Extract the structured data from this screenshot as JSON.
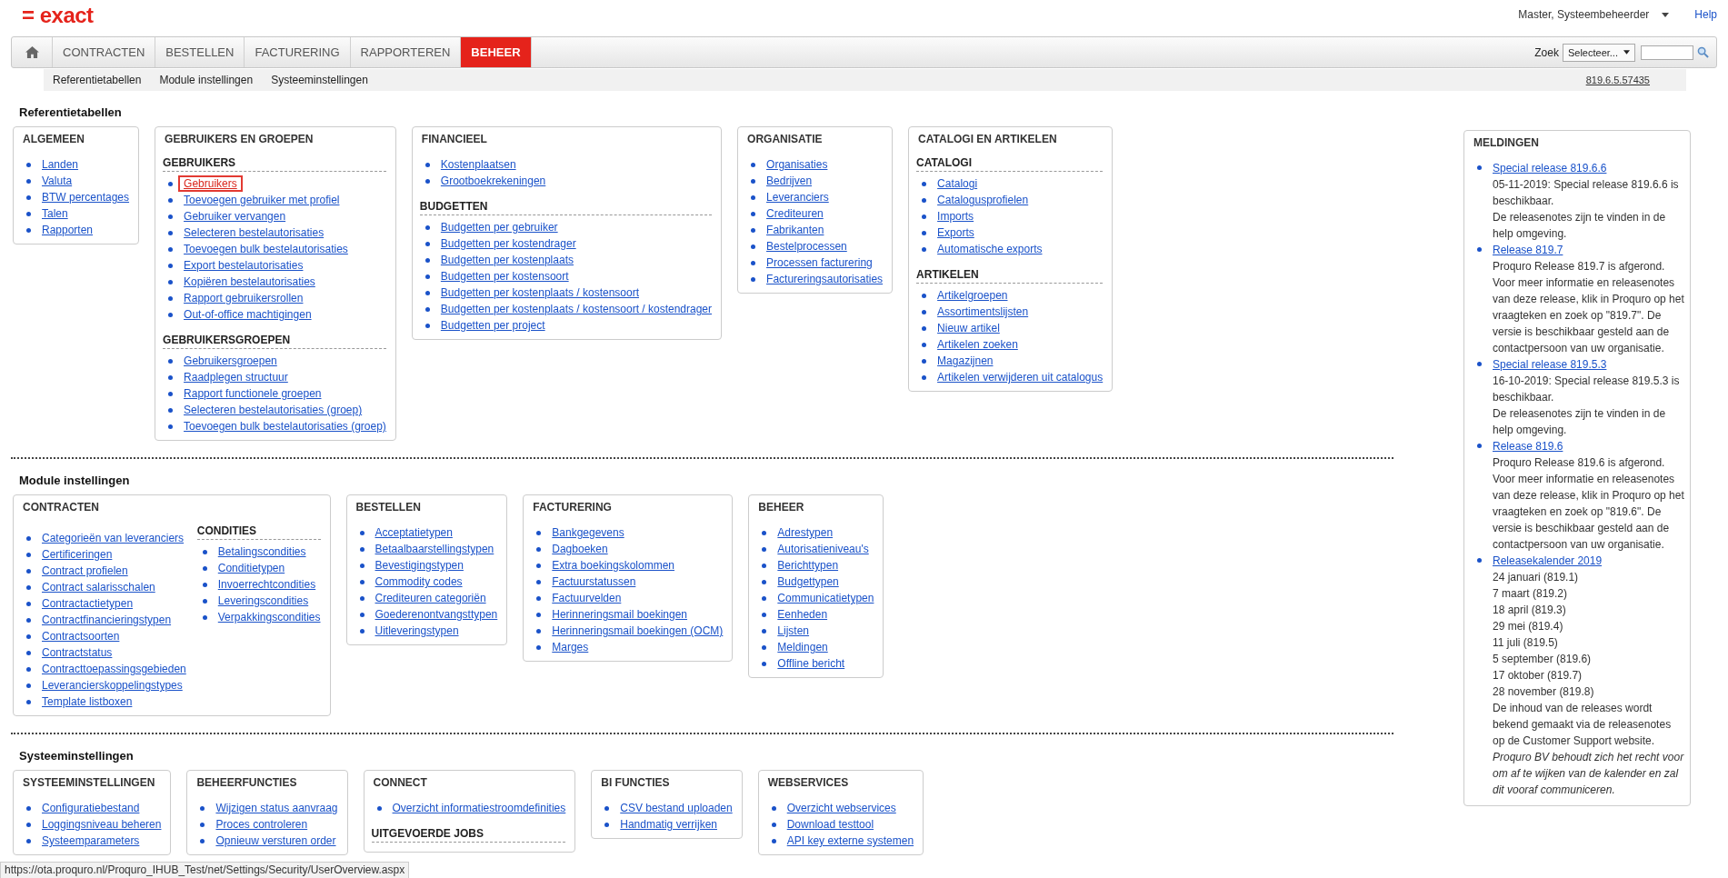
{
  "header": {
    "logo": "= exact",
    "user": "Master, Systeembeheerder",
    "help": "Help"
  },
  "nav": {
    "tabs": [
      {
        "label": "CONTRACTEN",
        "selected": false
      },
      {
        "label": "BESTELLEN",
        "selected": false
      },
      {
        "label": "FACTURERING",
        "selected": false
      },
      {
        "label": "RAPPORTEREN",
        "selected": false
      },
      {
        "label": "BEHEER",
        "selected": true
      }
    ],
    "search": {
      "label": "Zoek",
      "select": "Selecteer..."
    }
  },
  "subnav": {
    "links": [
      "Referentietabellen",
      "Module instellingen",
      "Systeeminstellingen"
    ],
    "version": "819.6.5.57435"
  },
  "sections": [
    {
      "title": "Referentietabellen",
      "boxes": [
        {
          "title": "ALGEMEEN",
          "kind": "stack",
          "groups": [
            {
              "links": [
                {
                  "label": "Landen",
                  "selected": false
                },
                {
                  "label": "Valuta",
                  "selected": false
                },
                {
                  "label": "BTW percentages",
                  "selected": false
                },
                {
                  "label": "Talen",
                  "selected": false
                },
                {
                  "label": "Rapporten",
                  "selected": false
                }
              ]
            }
          ]
        },
        {
          "title": "GEBRUIKERS EN GROEPEN",
          "kind": "stack",
          "groups": [
            {
              "heading": "GEBRUIKERS",
              "links": [
                {
                  "label": "Gebruikers",
                  "selected": true
                },
                {
                  "label": "Toevoegen gebruiker met profiel",
                  "selected": false
                },
                {
                  "label": "Gebruiker vervangen",
                  "selected": false
                },
                {
                  "label": "Selecteren bestelautorisaties",
                  "selected": false
                },
                {
                  "label": "Toevoegen bulk bestelautorisaties",
                  "selected": false
                },
                {
                  "label": "Export bestelautorisaties",
                  "selected": false
                },
                {
                  "label": "Kopiëren bestelautorisaties",
                  "selected": false
                },
                {
                  "label": "Rapport gebruikersrollen",
                  "selected": false
                },
                {
                  "label": "Out-of-office machtigingen",
                  "selected": false
                }
              ]
            },
            {
              "heading": "GEBRUIKERSGROEPEN",
              "links": [
                {
                  "label": "Gebruikersgroepen",
                  "selected": false
                },
                {
                  "label": "Raadplegen structuur",
                  "selected": false
                },
                {
                  "label": "Rapport functionele groepen",
                  "selected": false
                },
                {
                  "label": "Selecteren bestelautorisaties (groep)",
                  "selected": false
                },
                {
                  "label": "Toevoegen bulk bestelautorisaties (groep)",
                  "selected": false
                }
              ]
            }
          ]
        },
        {
          "title": "FINANCIEEL",
          "kind": "stack",
          "groups": [
            {
              "links": [
                {
                  "label": "Kostenplaatsen",
                  "selected": false
                },
                {
                  "label": "Grootboekrekeningen",
                  "selected": false
                }
              ]
            },
            {
              "heading": "BUDGETTEN",
              "links": [
                {
                  "label": "Budgetten per gebruiker",
                  "selected": false
                },
                {
                  "label": "Budgetten per kostendrager",
                  "selected": false
                },
                {
                  "label": "Budgetten per kostenplaats",
                  "selected": false
                },
                {
                  "label": "Budgetten per kostensoort",
                  "selected": false
                },
                {
                  "label": "Budgetten per kostenplaats / kostensoort",
                  "selected": false
                },
                {
                  "label": "Budgetten per kostenplaats / kostensoort / kostendrager",
                  "selected": false
                },
                {
                  "label": "Budgetten per project",
                  "selected": false
                }
              ]
            }
          ]
        },
        {
          "title": "ORGANISATIE",
          "kind": "stack",
          "groups": [
            {
              "links": [
                {
                  "label": "Organisaties",
                  "selected": false
                },
                {
                  "label": "Bedrijven",
                  "selected": false
                },
                {
                  "label": "Leveranciers",
                  "selected": false
                },
                {
                  "label": "Crediteuren",
                  "selected": false
                },
                {
                  "label": "Fabrikanten",
                  "selected": false
                },
                {
                  "label": "Bestelprocessen",
                  "selected": false
                },
                {
                  "label": "Processen facturering",
                  "selected": false
                },
                {
                  "label": "Factureringsautorisaties",
                  "selected": false
                }
              ]
            }
          ]
        },
        {
          "title": "CATALOGI EN ARTIKELEN",
          "kind": "stack",
          "groups": [
            {
              "heading": "CATALOGI",
              "links": [
                {
                  "label": "Catalogi",
                  "selected": false
                },
                {
                  "label": "Catalogusprofielen",
                  "selected": false
                },
                {
                  "label": "Imports",
                  "selected": false
                },
                {
                  "label": "Exports",
                  "selected": false
                },
                {
                  "label": "Automatische exports",
                  "selected": false
                }
              ]
            },
            {
              "heading": "ARTIKELEN",
              "links": [
                {
                  "label": "Artikelgroepen",
                  "selected": false
                },
                {
                  "label": "Assortimentslijsten",
                  "selected": false
                },
                {
                  "label": "Nieuw artikel",
                  "selected": false
                },
                {
                  "label": "Artikelen zoeken",
                  "selected": false
                },
                {
                  "label": "Magazijnen",
                  "selected": false
                },
                {
                  "label": "Artikelen verwijderen uit catalogus",
                  "selected": false
                }
              ]
            }
          ]
        }
      ]
    },
    {
      "title": "Module instellingen",
      "boxes": [
        {
          "title": "CONTRACTEN",
          "kind": "columns",
          "groups": [
            {
              "links": [
                {
                  "label": "Categorieën van leveranciers",
                  "selected": false
                },
                {
                  "label": "Certificeringen",
                  "selected": false
                },
                {
                  "label": "Contract profielen",
                  "selected": false
                },
                {
                  "label": "Contract salarisschalen",
                  "selected": false
                },
                {
                  "label": "Contractactietypen",
                  "selected": false
                },
                {
                  "label": "Contractfinancieringstypen",
                  "selected": false
                },
                {
                  "label": "Contractsoorten",
                  "selected": false
                },
                {
                  "label": "Contractstatus",
                  "selected": false
                },
                {
                  "label": "Contracttoepassingsgebieden",
                  "selected": false
                },
                {
                  "label": "Leverancierskoppelingstypes",
                  "selected": false
                },
                {
                  "label": "Template listboxen",
                  "selected": false
                }
              ]
            },
            {
              "heading": "CONDITIES",
              "links": [
                {
                  "label": "Betalingscondities",
                  "selected": false
                },
                {
                  "label": "Conditietypen",
                  "selected": false
                },
                {
                  "label": "Invoerrechtcondities",
                  "selected": false
                },
                {
                  "label": "Leveringscondities",
                  "selected": false
                },
                {
                  "label": "Verpakkingscondities",
                  "selected": false
                }
              ]
            }
          ]
        },
        {
          "title": "BESTELLEN",
          "kind": "stack",
          "groups": [
            {
              "links": [
                {
                  "label": "Acceptatietypen",
                  "selected": false
                },
                {
                  "label": "Betaalbaarstellingstypen",
                  "selected": false
                },
                {
                  "label": "Bevestigingstypen",
                  "selected": false
                },
                {
                  "label": "Commodity codes",
                  "selected": false
                },
                {
                  "label": "Crediteuren categoriën",
                  "selected": false
                },
                {
                  "label": "Goederenontvangsttypen",
                  "selected": false
                },
                {
                  "label": "Uitleveringstypen",
                  "selected": false
                }
              ]
            }
          ]
        },
        {
          "title": "FACTURERING",
          "kind": "stack",
          "groups": [
            {
              "links": [
                {
                  "label": "Bankgegevens",
                  "selected": false
                },
                {
                  "label": "Dagboeken",
                  "selected": false
                },
                {
                  "label": "Extra boekingskolommen",
                  "selected": false
                },
                {
                  "label": "Factuurstatussen",
                  "selected": false
                },
                {
                  "label": "Factuurvelden",
                  "selected": false
                },
                {
                  "label": "Herinneringsmail boekingen",
                  "selected": false
                },
                {
                  "label": "Herinneringsmail boekingen (OCM)",
                  "selected": false
                },
                {
                  "label": "Marges",
                  "selected": false
                }
              ]
            }
          ]
        },
        {
          "title": "BEHEER",
          "kind": "stack",
          "groups": [
            {
              "links": [
                {
                  "label": "Adrestypen",
                  "selected": false
                },
                {
                  "label": "Autorisatieniveau's",
                  "selected": false
                },
                {
                  "label": "Berichttypen",
                  "selected": false
                },
                {
                  "label": "Budgettypen",
                  "selected": false
                },
                {
                  "label": "Communicatietypen",
                  "selected": false
                },
                {
                  "label": "Eenheden",
                  "selected": false
                },
                {
                  "label": "Lijsten",
                  "selected": false
                },
                {
                  "label": "Meldingen",
                  "selected": false
                },
                {
                  "label": "Offline bericht",
                  "selected": false
                }
              ]
            }
          ]
        }
      ]
    },
    {
      "title": "Systeeminstellingen",
      "boxes": [
        {
          "title": "SYSTEEMINSTELLINGEN",
          "kind": "stack",
          "groups": [
            {
              "links": [
                {
                  "label": "Configuratiebestand",
                  "selected": false
                },
                {
                  "label": "Loggingsniveau beheren",
                  "selected": false
                },
                {
                  "label": "Systeemparameters",
                  "selected": false
                }
              ]
            }
          ]
        },
        {
          "title": "BEHEERFUNCTIES",
          "kind": "stack",
          "groups": [
            {
              "links": [
                {
                  "label": "Wijzigen status aanvraag",
                  "selected": false
                },
                {
                  "label": "Proces controleren",
                  "selected": false
                },
                {
                  "label": "Opnieuw versturen order",
                  "selected": false
                }
              ]
            }
          ]
        },
        {
          "title": "CONNECT",
          "kind": "stack",
          "groups": [
            {
              "links": [
                {
                  "label": "Overzicht informatiestroomdefinities",
                  "selected": false
                }
              ]
            },
            {
              "heading": "UITGEVOERDE JOBS"
            }
          ]
        },
        {
          "title": "BI FUNCTIES",
          "kind": "stack",
          "groups": [
            {
              "links": [
                {
                  "label": "CSV bestand uploaden",
                  "selected": false
                },
                {
                  "label": "Handmatig verrijken",
                  "selected": false
                }
              ]
            }
          ]
        },
        {
          "title": "WEBSERVICES",
          "kind": "stack",
          "groups": [
            {
              "links": [
                {
                  "label": "Overzicht webservices",
                  "selected": false
                },
                {
                  "label": "Download testtool",
                  "selected": false
                },
                {
                  "label": "API key externe systemen",
                  "selected": false
                }
              ]
            }
          ]
        }
      ]
    }
  ],
  "notifications": {
    "title": "MELDINGEN",
    "items": [
      {
        "title": "Special release 819.6.6",
        "lines": [
          "05-11-2019: Special release 819.6.6 is beschikbaar.",
          "De releasenotes zijn te vinden in de help omgeving."
        ]
      },
      {
        "title": "Release 819.7",
        "lines": [
          "Proquro Release 819.7 is afgerond. Voor meer informatie en releasenotes van deze release, klik in Proquro op het vraagteken en zoek op \"819.7\". De versie is beschikbaar gesteld aan de contactpersoon van uw organisatie."
        ]
      },
      {
        "title": "Special release 819.5.3",
        "lines": [
          "16-10-2019: Special release 819.5.3 is beschikbaar.",
          "De releasenotes zijn te vinden in de help omgeving."
        ]
      },
      {
        "title": "Release 819.6",
        "lines": [
          "Proquro Release 819.6 is afgerond. Voor meer informatie en releasenotes van deze release, klik in Proquro op het vraagteken en zoek op \"819.6\". De versie is beschikbaar gesteld aan de contactpersoon van uw organisatie."
        ]
      },
      {
        "title": "Releasekalender 2019",
        "lines": [
          "24 januari (819.1)",
          "7 maart (819.2)",
          "18 april (819.3)",
          "29 mei (819.4)",
          "11 juli (819.5)",
          "5 september (819.6)",
          "17 oktober (819.7)",
          "28 november (819.8)",
          "De inhoud van de releases wordt bekend gemaakt via de releasenotes op de Customer Support website."
        ],
        "note": "Proquro BV behoudt zich het recht voor om af te wijken van de kalender en zal dit vooraf communiceren."
      }
    ]
  },
  "status_bar": {
    "url": "https://ota.proquro.nl/Proquro_IHUB_Test/net/Settings/Security/UserOverview.aspx"
  }
}
